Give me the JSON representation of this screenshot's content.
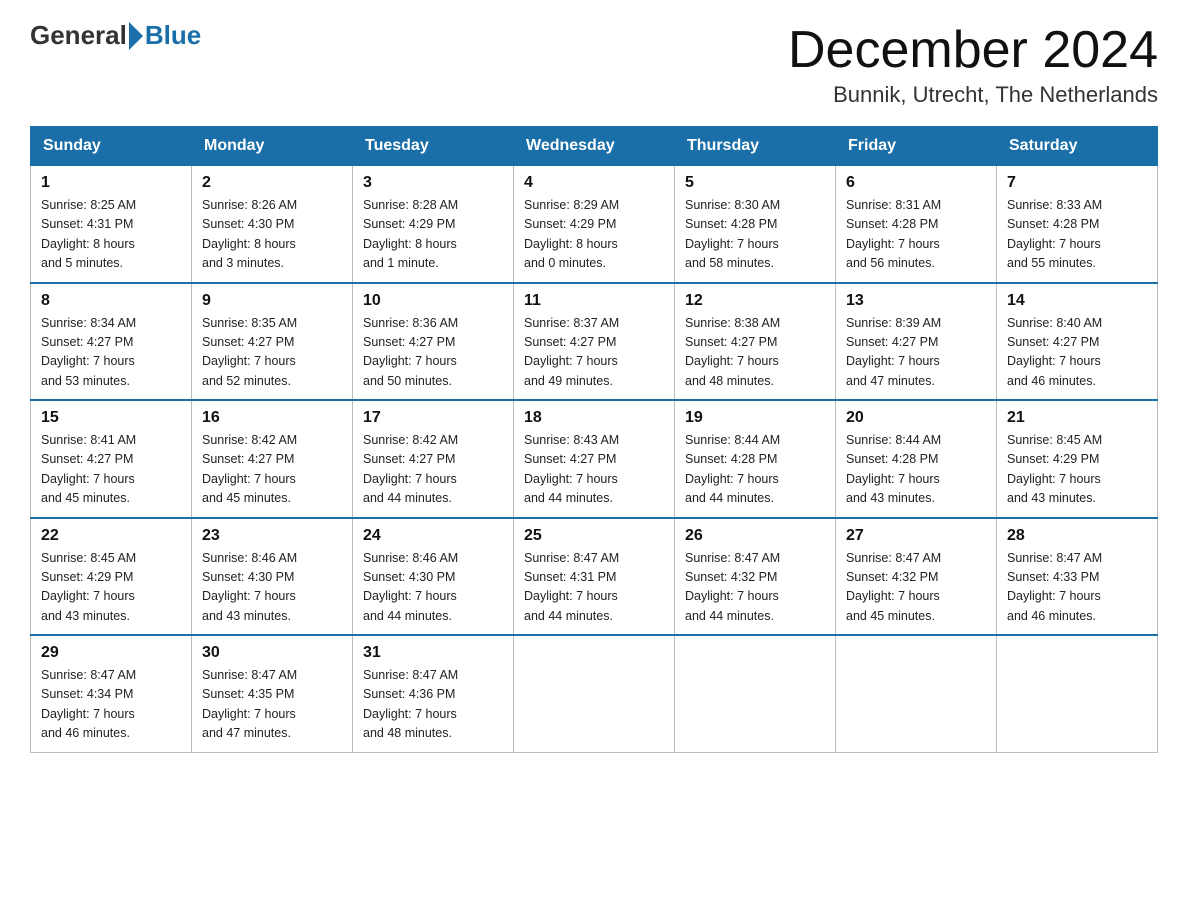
{
  "header": {
    "logo_general": "General",
    "logo_blue": "Blue",
    "month_title": "December 2024",
    "location": "Bunnik, Utrecht, The Netherlands"
  },
  "days_of_week": [
    "Sunday",
    "Monday",
    "Tuesday",
    "Wednesday",
    "Thursday",
    "Friday",
    "Saturday"
  ],
  "weeks": [
    [
      {
        "day": "1",
        "sunrise": "8:25 AM",
        "sunset": "4:31 PM",
        "daylight": "8 hours and 5 minutes."
      },
      {
        "day": "2",
        "sunrise": "8:26 AM",
        "sunset": "4:30 PM",
        "daylight": "8 hours and 3 minutes."
      },
      {
        "day": "3",
        "sunrise": "8:28 AM",
        "sunset": "4:29 PM",
        "daylight": "8 hours and 1 minute."
      },
      {
        "day": "4",
        "sunrise": "8:29 AM",
        "sunset": "4:29 PM",
        "daylight": "8 hours and 0 minutes."
      },
      {
        "day": "5",
        "sunrise": "8:30 AM",
        "sunset": "4:28 PM",
        "daylight": "7 hours and 58 minutes."
      },
      {
        "day": "6",
        "sunrise": "8:31 AM",
        "sunset": "4:28 PM",
        "daylight": "7 hours and 56 minutes."
      },
      {
        "day": "7",
        "sunrise": "8:33 AM",
        "sunset": "4:28 PM",
        "daylight": "7 hours and 55 minutes."
      }
    ],
    [
      {
        "day": "8",
        "sunrise": "8:34 AM",
        "sunset": "4:27 PM",
        "daylight": "7 hours and 53 minutes."
      },
      {
        "day": "9",
        "sunrise": "8:35 AM",
        "sunset": "4:27 PM",
        "daylight": "7 hours and 52 minutes."
      },
      {
        "day": "10",
        "sunrise": "8:36 AM",
        "sunset": "4:27 PM",
        "daylight": "7 hours and 50 minutes."
      },
      {
        "day": "11",
        "sunrise": "8:37 AM",
        "sunset": "4:27 PM",
        "daylight": "7 hours and 49 minutes."
      },
      {
        "day": "12",
        "sunrise": "8:38 AM",
        "sunset": "4:27 PM",
        "daylight": "7 hours and 48 minutes."
      },
      {
        "day": "13",
        "sunrise": "8:39 AM",
        "sunset": "4:27 PM",
        "daylight": "7 hours and 47 minutes."
      },
      {
        "day": "14",
        "sunrise": "8:40 AM",
        "sunset": "4:27 PM",
        "daylight": "7 hours and 46 minutes."
      }
    ],
    [
      {
        "day": "15",
        "sunrise": "8:41 AM",
        "sunset": "4:27 PM",
        "daylight": "7 hours and 45 minutes."
      },
      {
        "day": "16",
        "sunrise": "8:42 AM",
        "sunset": "4:27 PM",
        "daylight": "7 hours and 45 minutes."
      },
      {
        "day": "17",
        "sunrise": "8:42 AM",
        "sunset": "4:27 PM",
        "daylight": "7 hours and 44 minutes."
      },
      {
        "day": "18",
        "sunrise": "8:43 AM",
        "sunset": "4:27 PM",
        "daylight": "7 hours and 44 minutes."
      },
      {
        "day": "19",
        "sunrise": "8:44 AM",
        "sunset": "4:28 PM",
        "daylight": "7 hours and 44 minutes."
      },
      {
        "day": "20",
        "sunrise": "8:44 AM",
        "sunset": "4:28 PM",
        "daylight": "7 hours and 43 minutes."
      },
      {
        "day": "21",
        "sunrise": "8:45 AM",
        "sunset": "4:29 PM",
        "daylight": "7 hours and 43 minutes."
      }
    ],
    [
      {
        "day": "22",
        "sunrise": "8:45 AM",
        "sunset": "4:29 PM",
        "daylight": "7 hours and 43 minutes."
      },
      {
        "day": "23",
        "sunrise": "8:46 AM",
        "sunset": "4:30 PM",
        "daylight": "7 hours and 43 minutes."
      },
      {
        "day": "24",
        "sunrise": "8:46 AM",
        "sunset": "4:30 PM",
        "daylight": "7 hours and 44 minutes."
      },
      {
        "day": "25",
        "sunrise": "8:47 AM",
        "sunset": "4:31 PM",
        "daylight": "7 hours and 44 minutes."
      },
      {
        "day": "26",
        "sunrise": "8:47 AM",
        "sunset": "4:32 PM",
        "daylight": "7 hours and 44 minutes."
      },
      {
        "day": "27",
        "sunrise": "8:47 AM",
        "sunset": "4:32 PM",
        "daylight": "7 hours and 45 minutes."
      },
      {
        "day": "28",
        "sunrise": "8:47 AM",
        "sunset": "4:33 PM",
        "daylight": "7 hours and 46 minutes."
      }
    ],
    [
      {
        "day": "29",
        "sunrise": "8:47 AM",
        "sunset": "4:34 PM",
        "daylight": "7 hours and 46 minutes."
      },
      {
        "day": "30",
        "sunrise": "8:47 AM",
        "sunset": "4:35 PM",
        "daylight": "7 hours and 47 minutes."
      },
      {
        "day": "31",
        "sunrise": "8:47 AM",
        "sunset": "4:36 PM",
        "daylight": "7 hours and 48 minutes."
      },
      null,
      null,
      null,
      null
    ]
  ],
  "labels": {
    "sunrise": "Sunrise:",
    "sunset": "Sunset:",
    "daylight": "Daylight:"
  }
}
